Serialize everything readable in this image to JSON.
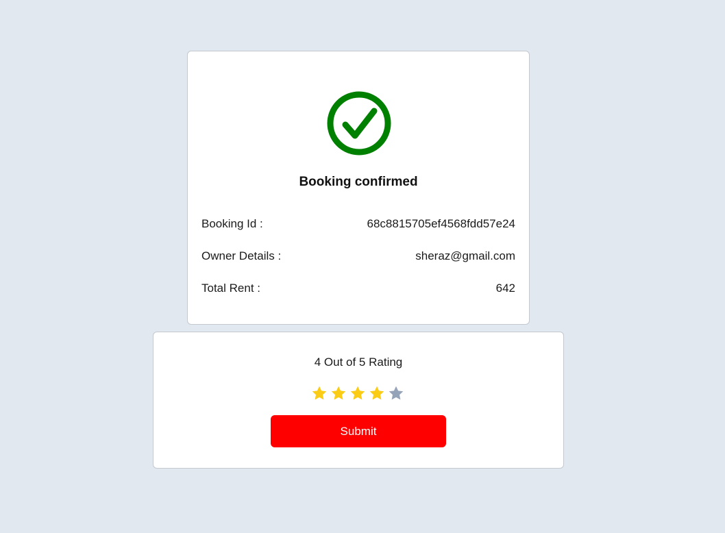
{
  "booking": {
    "title": "Booking confirmed",
    "status_icon": "check-circle-icon",
    "status_color": "#008000",
    "details": [
      {
        "label": "Booking Id :",
        "value": "68c8815705ef4568fdd57e24"
      },
      {
        "label": "Owner Details :",
        "value": "sheraz@gmail.com"
      },
      {
        "label": "Total Rent :",
        "value": "642"
      }
    ]
  },
  "rating": {
    "text": "4 Out of 5 Rating",
    "value": 4,
    "max": 5,
    "filled_color": "#facc15",
    "empty_color": "#94a3b8",
    "submit_label": "Submit",
    "submit_color": "#ff0000"
  }
}
